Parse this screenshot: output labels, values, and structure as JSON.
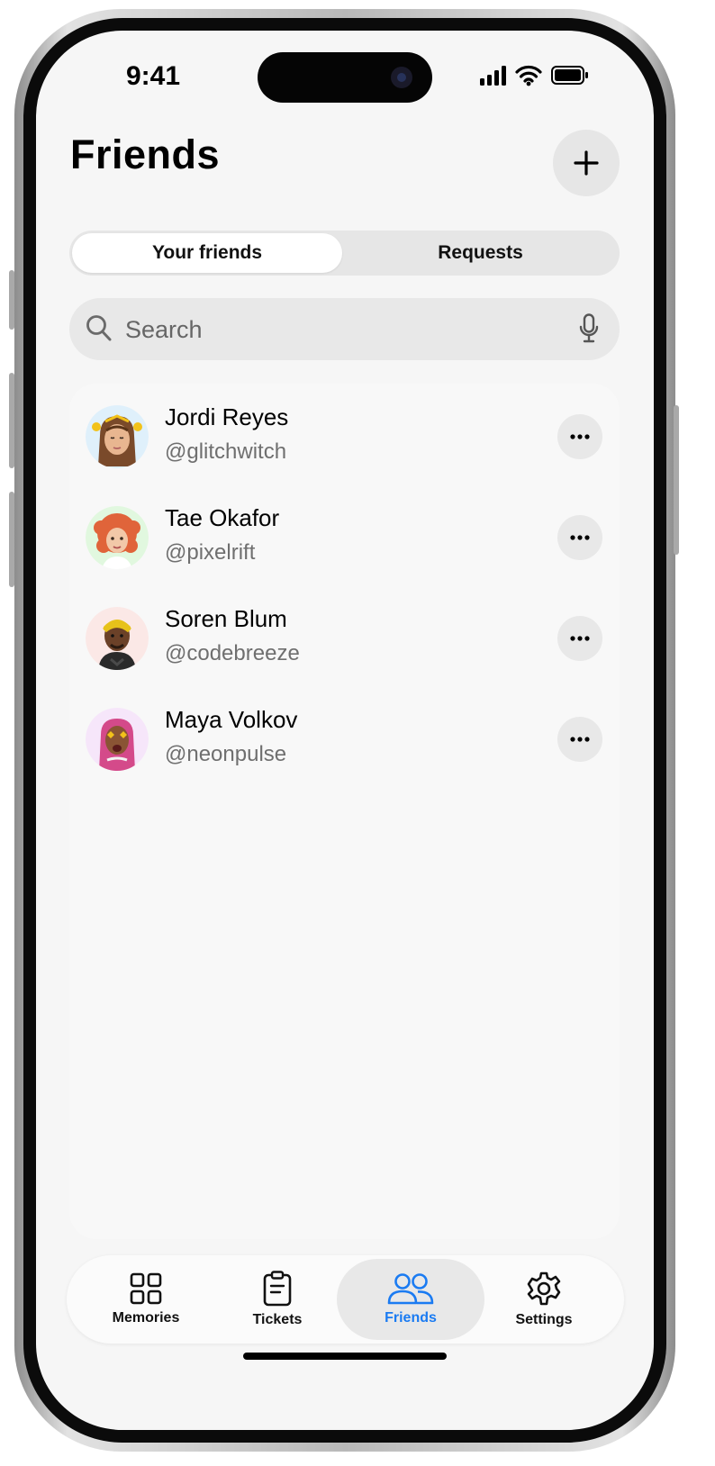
{
  "status_bar": {
    "time": "9:41"
  },
  "header": {
    "title": "Friends",
    "add_icon": "plus-icon"
  },
  "segmented_control": {
    "options": [
      {
        "label": "Your friends",
        "selected": true
      },
      {
        "label": "Requests",
        "selected": false
      }
    ]
  },
  "search": {
    "placeholder": "Search",
    "value": ""
  },
  "friends": [
    {
      "name": "Jordi Reyes",
      "handle": "@glitchwitch",
      "avatar_bg": "#dff0fb"
    },
    {
      "name": "Tae Okafor",
      "handle": "@pixelrift",
      "avatar_bg": "#e1f8df"
    },
    {
      "name": "Soren Blum",
      "handle": "@codebreeze",
      "avatar_bg": "#fbe8e6"
    },
    {
      "name": "Maya Volkov",
      "handle": "@neonpulse",
      "avatar_bg": "#f6e6fa"
    }
  ],
  "tab_bar": {
    "tabs": [
      {
        "label": "Memories",
        "icon": "grid-icon",
        "active": false
      },
      {
        "label": "Tickets",
        "icon": "clipboard-icon",
        "active": false
      },
      {
        "label": "Friends",
        "icon": "people-icon",
        "active": true
      },
      {
        "label": "Settings",
        "icon": "gear-icon",
        "active": false
      }
    ]
  },
  "colors": {
    "accent": "#1a7bf2",
    "background": "#f6f6f6",
    "secondary_text": "#6f6f6f"
  }
}
